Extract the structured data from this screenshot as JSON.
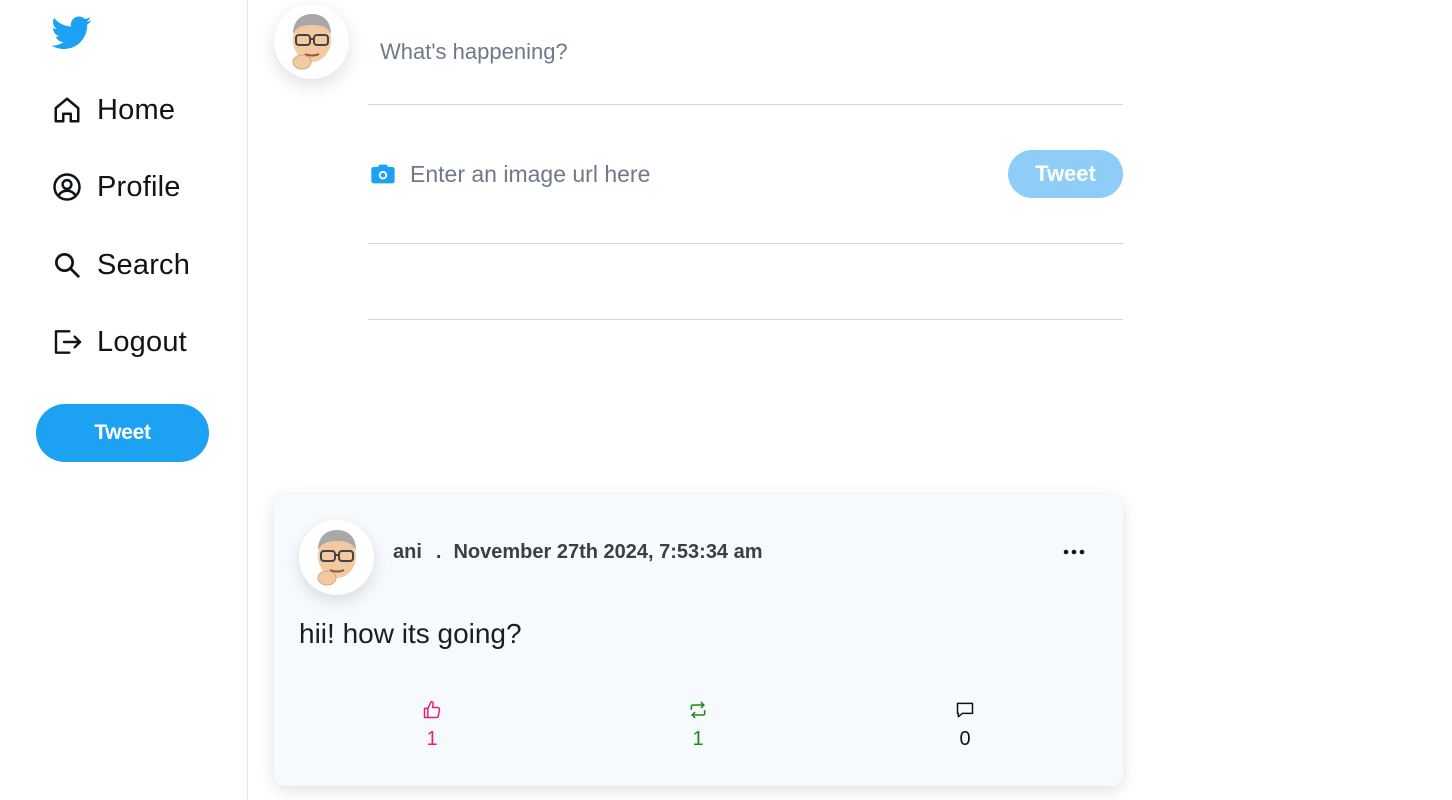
{
  "sidebar": {
    "logo_icon": "twitter-bird-icon",
    "brand_color": "#1da1f2",
    "items": [
      {
        "label": "Home",
        "icon": "home-icon"
      },
      {
        "label": "Profile",
        "icon": "user-circle-icon"
      },
      {
        "label": "Search",
        "icon": "search-icon"
      },
      {
        "label": "Logout",
        "icon": "logout-icon"
      }
    ],
    "tweet_button": "Tweet"
  },
  "composer": {
    "text_placeholder": "What's happening?",
    "image_placeholder": "Enter an image url here",
    "image_icon": "camera-icon",
    "tweet_button": "Tweet",
    "tweet_button_color": "#8ecdf8"
  },
  "feed": {
    "tweets": [
      {
        "author": "ani",
        "separator": ".",
        "timestamp": "November 27th 2024, 7:53:34 am",
        "text": "hii! how its going?",
        "likes": "1",
        "retweets": "1",
        "comments": "0",
        "like_color": "#e0247a",
        "retweet_color": "#1b8a1b"
      }
    ]
  }
}
